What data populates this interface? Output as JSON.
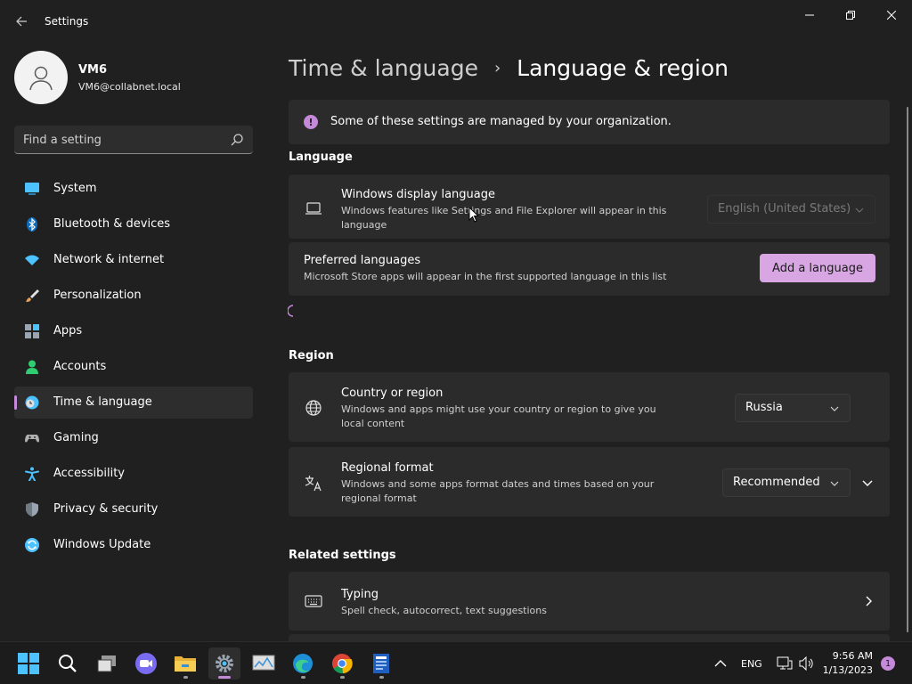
{
  "window": {
    "title": "Settings",
    "controls": [
      "minimize",
      "maximize",
      "close"
    ]
  },
  "profile": {
    "name": "VM6",
    "email": "VM6@collabnet.local"
  },
  "search": {
    "placeholder": "Find a setting"
  },
  "sidebar": {
    "items": [
      {
        "label": "System",
        "icon": "display-icon",
        "color": "#4cc2ff"
      },
      {
        "label": "Bluetooth & devices",
        "icon": "bluetooth-icon",
        "color": "#0f6cbd"
      },
      {
        "label": "Network & internet",
        "icon": "wifi-icon",
        "color": "#4cc2ff"
      },
      {
        "label": "Personalization",
        "icon": "brush-icon",
        "color": "#e8a35a"
      },
      {
        "label": "Apps",
        "icon": "apps-icon",
        "color": "#9aa5b1"
      },
      {
        "label": "Accounts",
        "icon": "person-icon",
        "color": "#2fcc71"
      },
      {
        "label": "Time & language",
        "icon": "clock-globe-icon",
        "color": "#4cc2ff",
        "active": true
      },
      {
        "label": "Gaming",
        "icon": "gamepad-icon",
        "color": "#b0b0b0"
      },
      {
        "label": "Accessibility",
        "icon": "accessibility-icon",
        "color": "#4cc2ff"
      },
      {
        "label": "Privacy & security",
        "icon": "shield-icon",
        "color": "#9aa5b1"
      },
      {
        "label": "Windows Update",
        "icon": "update-icon",
        "color": "#4cc2ff"
      }
    ]
  },
  "breadcrumb": {
    "parent": "Time & language",
    "separator": "›",
    "current": "Language & region"
  },
  "org_notice": {
    "text": "Some of these settings are managed by your organization."
  },
  "language_section": {
    "heading": "Language",
    "display_language": {
      "title": "Windows display language",
      "description": "Windows features like Settings and File Explorer will appear in this language",
      "value": "English (United States)",
      "disabled": true
    },
    "preferred": {
      "title": "Preferred languages",
      "description": "Microsoft Store apps will appear in the first supported language in this list",
      "button": "Add a language"
    }
  },
  "region_section": {
    "heading": "Region",
    "country": {
      "title": "Country or region",
      "description": "Windows and apps might use your country or region to give you local content",
      "value": "Russia"
    },
    "format": {
      "title": "Regional format",
      "description": "Windows and some apps format dates and times based on your regional format",
      "value": "Recommended"
    }
  },
  "related_section": {
    "heading": "Related settings",
    "typing": {
      "title": "Typing",
      "description": "Spell check, autocorrect, text suggestions"
    }
  },
  "taskbar": {
    "apps": [
      "start",
      "search",
      "task-view",
      "zoom",
      "file-explorer",
      "settings",
      "resource-monitor",
      "edge",
      "chrome",
      "installer"
    ],
    "tray": {
      "language": "ENG",
      "time": "9:56 AM",
      "date": "1/13/2023",
      "notifications": "1"
    }
  },
  "colors": {
    "accent": "#c589d9",
    "accent_button": "#d7a6e3",
    "background": "#202020",
    "card": "#2b2b2b"
  }
}
